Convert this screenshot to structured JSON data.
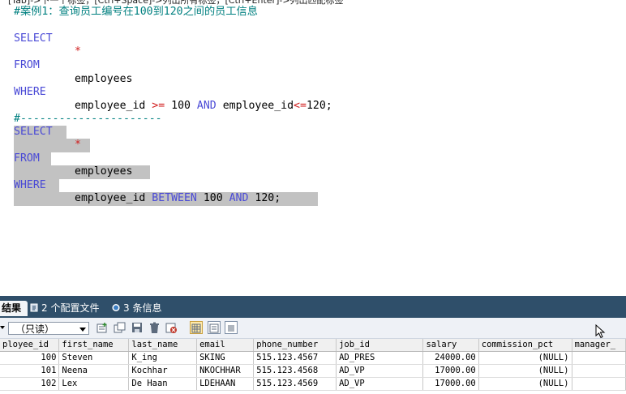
{
  "hint": "[Tab]->下一个标签，[Ctrl+Space]->列出所有标签，[Ctrl+Enter]->列出匹配标签",
  "editor": {
    "comment_title": "#案例1：查询员工编号在100到120之间的员工信息",
    "q1": {
      "select_kw": "SELECT",
      "star": "*",
      "from_kw": "FROM",
      "table": "employees",
      "where_kw": "WHERE",
      "col1": "employee_id",
      "op1": ">=",
      "val1": "100",
      "and_kw": "AND",
      "col2": "employee_id",
      "op2": "<=",
      "val2": "120;"
    },
    "separator": "#----------------------",
    "q2": {
      "select_kw": "SELECT",
      "star": "*",
      "from_kw": "FROM",
      "table": "employees",
      "where_kw": "WHERE",
      "col": "employee_id",
      "between_kw": "BETWEEN",
      "val1": "100",
      "and_kw": "AND",
      "val2": "120;"
    }
  },
  "tabs": {
    "result": "结果",
    "profile": "2 个配置文件",
    "info": "3 条信息"
  },
  "toolbar": {
    "mode": "（只读）"
  },
  "grid": {
    "columns": [
      "ployee_id",
      "first_name",
      "last_name",
      "email",
      "phone_number",
      "job_id",
      "salary",
      "commission_pct",
      "manager_"
    ],
    "rows": [
      [
        "100",
        "Steven",
        "K_ing",
        "SKING",
        "515.123.4567",
        "AD_PRES",
        "24000.00",
        "(NULL)",
        ""
      ],
      [
        "101",
        "Neena",
        "Kochhar",
        "NKOCHHAR",
        "515.123.4568",
        "AD_VP",
        "17000.00",
        "(NULL)",
        ""
      ],
      [
        "102",
        "Lex",
        "De Haan",
        "LDEHAAN",
        "515.123.4569",
        "AD_VP",
        "17000.00",
        "(NULL)",
        ""
      ]
    ]
  },
  "colors": {
    "keyword": "#4a4ad6",
    "comment": "#008080",
    "operator": "#d01c1c",
    "selection": "#c2c2c2",
    "panel_header": "#2f4f6a"
  }
}
